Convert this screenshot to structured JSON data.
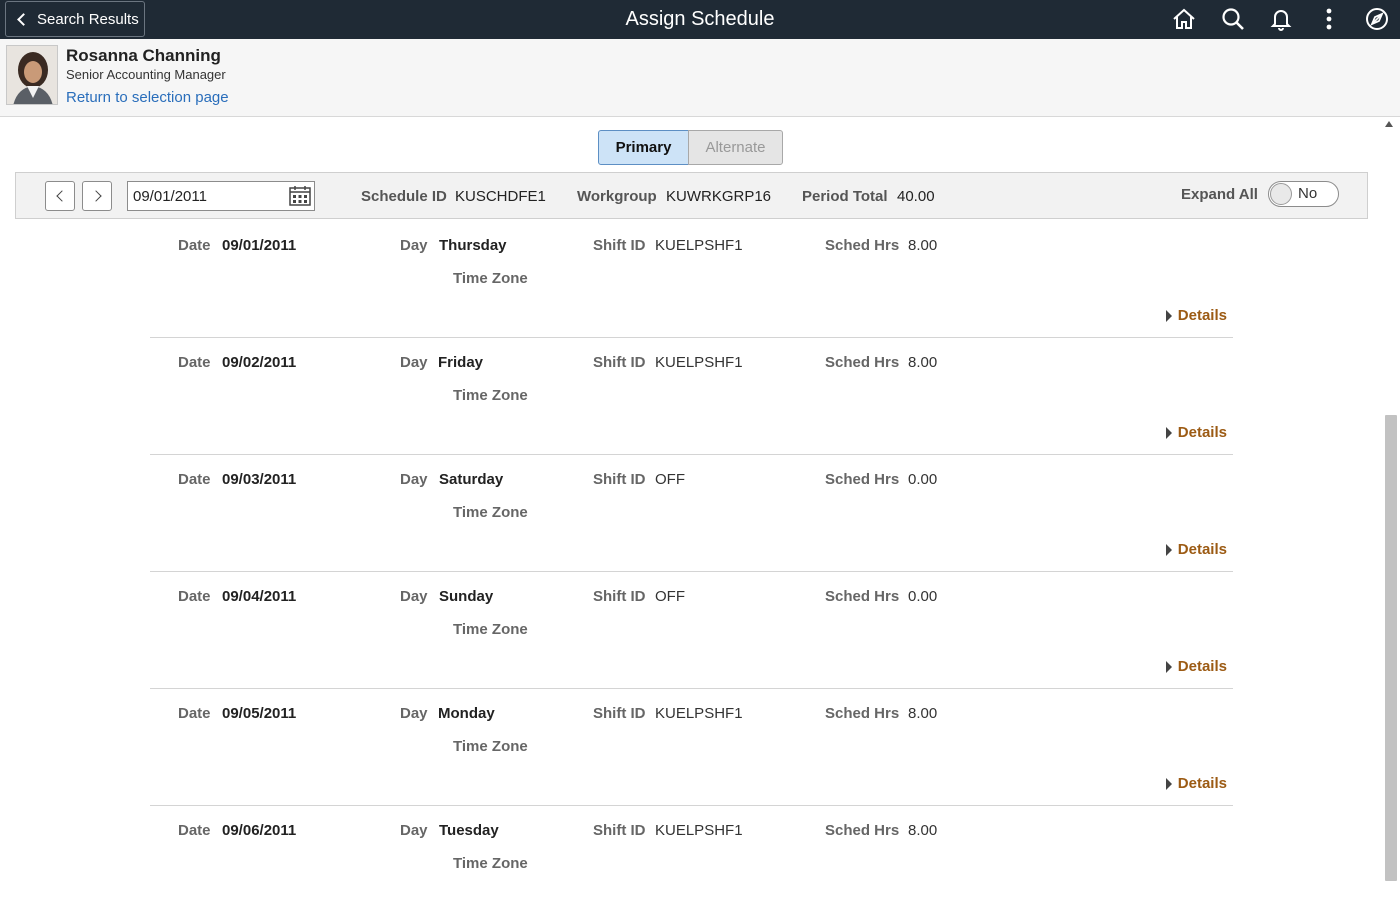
{
  "banner": {
    "back_label": "Search Results",
    "title": "Assign Schedule",
    "icons": [
      "home-icon",
      "search-icon",
      "bell-icon",
      "more-vertical-icon",
      "compass-icon"
    ]
  },
  "person": {
    "name": "Rosanna Channing",
    "title": "Senior Accounting Manager",
    "return_link": "Return to selection page"
  },
  "schedule_toggle": {
    "primary": "Primary",
    "alternate": "Alternate",
    "selected": "Primary"
  },
  "filter": {
    "date": "09/01/2011",
    "schedule_id_label": "Schedule ID",
    "schedule_id": "KUSCHDFE1",
    "workgroup_label": "Workgroup",
    "workgroup": "KUWRKGRP16",
    "period_total_label": "Period Total",
    "period_total": "40.00",
    "expand_all_label": "Expand All",
    "expand_all_value": "No"
  },
  "labels": {
    "date": "Date",
    "day": "Day",
    "shift_id": "Shift ID",
    "sched_hrs": "Sched Hrs",
    "time_zone": "Time Zone",
    "details": "Details"
  },
  "rows": [
    {
      "date": "09/01/2011",
      "day": "Thursday",
      "shift_id": "KUELPSHF1",
      "sched_hrs": "8.00"
    },
    {
      "date": "09/02/2011",
      "day": "Friday",
      "shift_id": "KUELPSHF1",
      "sched_hrs": "8.00"
    },
    {
      "date": "09/03/2011",
      "day": "Saturday",
      "shift_id": "OFF",
      "sched_hrs": "0.00"
    },
    {
      "date": "09/04/2011",
      "day": "Sunday",
      "shift_id": "OFF",
      "sched_hrs": "0.00"
    },
    {
      "date": "09/05/2011",
      "day": "Monday",
      "shift_id": "KUELPSHF1",
      "sched_hrs": "8.00"
    },
    {
      "date": "09/06/2011",
      "day": "Tuesday",
      "shift_id": "KUELPSHF1",
      "sched_hrs": "8.00"
    }
  ]
}
